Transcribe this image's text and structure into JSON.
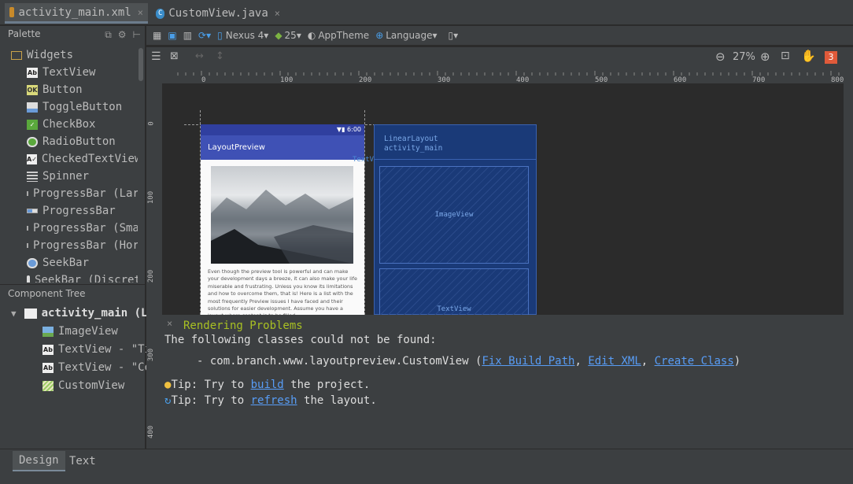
{
  "tabs": [
    {
      "label": "activity_main.xml",
      "icon": "xml-file-icon",
      "active": true
    },
    {
      "label": "CustomView.java",
      "icon": "java-class-icon",
      "active": false
    }
  ],
  "palette": {
    "title": "Palette",
    "group": "Widgets",
    "items": [
      {
        "label": "TextView",
        "icon": "textview-icon"
      },
      {
        "label": "Button",
        "icon": "button-icon"
      },
      {
        "label": "ToggleButton",
        "icon": "togglebutton-icon"
      },
      {
        "label": "CheckBox",
        "icon": "checkbox-icon"
      },
      {
        "label": "RadioButton",
        "icon": "radiobutton-icon"
      },
      {
        "label": "CheckedTextView",
        "icon": "checkedtextview-icon"
      },
      {
        "label": "Spinner",
        "icon": "spinner-icon"
      },
      {
        "label": "ProgressBar (Larg",
        "icon": "progressbar-icon"
      },
      {
        "label": "ProgressBar",
        "icon": "progressbar-icon"
      },
      {
        "label": "ProgressBar (Sma",
        "icon": "progressbar-icon"
      },
      {
        "label": "ProgressBar (Hor",
        "icon": "progressbar-icon"
      },
      {
        "label": "SeekBar",
        "icon": "seekbar-icon"
      },
      {
        "label": "SeekBar (Discrete",
        "icon": "seekbar-icon"
      }
    ]
  },
  "component_tree": {
    "title": "Component Tree",
    "root": "activity_main (L",
    "children": [
      {
        "label": "ImageView",
        "icon": "imageview-icon"
      },
      {
        "label": "TextView - \"Ti",
        "icon": "textview-icon"
      },
      {
        "label": "TextView - \"Co",
        "icon": "textview-icon"
      },
      {
        "label": "CustomView",
        "icon": "customview-icon"
      }
    ]
  },
  "toolbar": {
    "device": "Nexus 4",
    "api": "25",
    "theme": "AppTheme",
    "language": "Language",
    "zoom": "27%",
    "badge": "3"
  },
  "ruler": {
    "h_ticks": [
      "0",
      "100",
      "200",
      "300",
      "400",
      "500",
      "600",
      "700",
      "800"
    ],
    "v_ticks": [
      "0",
      "100",
      "200",
      "300",
      "400"
    ]
  },
  "preview": {
    "status_time": "6:00",
    "app_title": "LayoutPreview",
    "body_text": "Even though the preview tool is powerful and can make your development days a breeze, it can also make your life miserable and frustrating. Unless you know its limitations and how to overcome them, that is! Here is a list with the most frequently Preview issues I have faced and their solutions for easier development. Assume you have a layout where content is to be filled...",
    "textview_hover": "TextView"
  },
  "blueprint": {
    "root_type": "LinearLayout",
    "root_id": "activity_main",
    "image_label": "ImageView",
    "text_label": "TextView"
  },
  "problems": {
    "title": "Rendering Problems",
    "line1": "The following classes could not be found:",
    "class_prefix": "- com.branch.www.layoutpreview.CustomView (",
    "fix_build_path": "Fix Build Path",
    "sep1": ", ",
    "edit_xml": "Edit XML",
    "sep2": ", ",
    "create_class": "Create Class",
    "class_suffix": ")",
    "tip1_prefix": "Tip: Try to ",
    "tip1_link": "build",
    "tip1_suffix": " the project.",
    "tip2_prefix": "Tip: Try to ",
    "tip2_link": "refresh",
    "tip2_suffix": " the layout."
  },
  "bottom_tabs": [
    {
      "label": "Design",
      "active": true
    },
    {
      "label": "Text",
      "active": false
    }
  ],
  "colors": {
    "bg": "#2b2b2b",
    "panel": "#3c3f41",
    "app_bar": "#3f51b5",
    "blueprint": "#1a3a78",
    "link": "#589df6",
    "problem_title": "#a8c023",
    "badge": "#e05a3a"
  }
}
